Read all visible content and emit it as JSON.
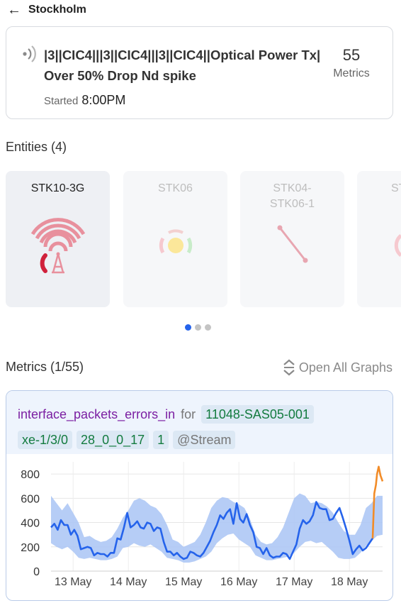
{
  "header": {
    "title": "Stockholm"
  },
  "alarm": {
    "title": "|3||CIC4|||3||CIC4|||3||CIC4||Optical Power Tx|  Over 50% Drop Nd spike",
    "started_label": "Started",
    "started_time": "8:00PM",
    "metric_count": "55",
    "metric_label": "Metrics"
  },
  "entities": {
    "heading": "Entities (4)",
    "items": [
      {
        "name": "STK10-3G",
        "icon": "cell-tower-icon",
        "active": true
      },
      {
        "name": "STK06",
        "icon": "status-light-icon",
        "active": false
      },
      {
        "name": "STK04-\nSTK06-1",
        "icon": "link-icon",
        "active": false
      },
      {
        "name": "ST",
        "icon": "partial-icon",
        "active": false
      }
    ],
    "pager": {
      "pages": 3,
      "current": 0
    }
  },
  "metrics": {
    "heading": "Metrics (1/55)",
    "open_all_label": "Open All Graphs",
    "card": {
      "metric_name": "interface_packets_errors_in",
      "for_label": "for",
      "tags": [
        "11048-SAS05-001",
        "xe-1/3/0",
        "28_0_0_17",
        "1"
      ],
      "stream_tag": "@Stream"
    }
  },
  "colors": {
    "accent": "#2563eb",
    "metric_purple": "#7b1fa2",
    "tag_green": "#137b3f",
    "band": "#a9c4f5",
    "anomaly": "#f28c28",
    "alert_red": "#d0213b"
  },
  "chart_data": {
    "type": "line",
    "title": "",
    "xlabel": "",
    "ylabel": "",
    "ylim": [
      0,
      900
    ],
    "yticks": [
      0,
      200,
      400,
      600,
      800
    ],
    "xticks": [
      "13 May",
      "14 May",
      "15 May",
      "16 May",
      "17 May",
      "18 May"
    ],
    "x_start_day": 12.6,
    "x_end_day": 18.5,
    "series": [
      {
        "name": "",
        "role": "value",
        "x": [
          12.6,
          12.66,
          12.72,
          12.78,
          12.84,
          12.9,
          12.96,
          13.02,
          13.08,
          13.14,
          13.2,
          13.26,
          13.32,
          13.38,
          13.44,
          13.5,
          13.56,
          13.62,
          13.68,
          13.74,
          13.8,
          13.86,
          13.92,
          13.98,
          14.04,
          14.1,
          14.16,
          14.22,
          14.28,
          14.34,
          14.4,
          14.46,
          14.52,
          14.58,
          14.64,
          14.7,
          14.76,
          14.82,
          14.88,
          14.94,
          15.0,
          15.06,
          15.12,
          15.18,
          15.24,
          15.3,
          15.36,
          15.42,
          15.48,
          15.54,
          15.6,
          15.66,
          15.72,
          15.78,
          15.84,
          15.9,
          15.96,
          16.02,
          16.08,
          16.14,
          16.2,
          16.26,
          16.32,
          16.38,
          16.44,
          16.5,
          16.56,
          16.62,
          16.68,
          16.74,
          16.8,
          16.86,
          16.92,
          16.98,
          17.04,
          17.1,
          17.16,
          17.22,
          17.28,
          17.34,
          17.4,
          17.46,
          17.52,
          17.58,
          17.64,
          17.7,
          17.76,
          17.82,
          17.88,
          17.94,
          18.0,
          18.06,
          18.12,
          18.18,
          18.24,
          18.3,
          18.36,
          18.42
        ],
        "y": [
          360,
          390,
          340,
          420,
          380,
          380,
          300,
          340,
          290,
          180,
          190,
          200,
          190,
          130,
          150,
          140,
          140,
          120,
          150,
          150,
          270,
          260,
          360,
          480,
          360,
          380,
          410,
          360,
          350,
          400,
          390,
          330,
          360,
          350,
          240,
          160,
          160,
          130,
          150,
          120,
          100,
          110,
          160,
          150,
          130,
          120,
          150,
          200,
          250,
          320,
          380,
          460,
          430,
          480,
          510,
          390,
          560,
          430,
          400,
          470,
          380,
          320,
          200,
          190,
          140,
          190,
          130,
          110,
          120,
          120,
          150,
          140,
          100,
          160,
          220,
          350,
          420,
          390,
          410,
          460,
          570,
          520,
          510,
          510,
          420,
          430,
          480,
          520,
          440,
          350,
          250,
          140,
          180,
          210,
          170,
          190,
          230,
          270
        ]
      },
      {
        "name": "",
        "role": "anomaly",
        "x": [
          18.42,
          18.45,
          18.48,
          18.5,
          18.53,
          18.56,
          18.6
        ],
        "y": [
          270,
          640,
          710,
          800,
          860,
          790,
          740
        ]
      }
    ],
    "band": {
      "x": [
        12.6,
        12.7,
        12.8,
        12.9,
        13.0,
        13.1,
        13.2,
        13.3,
        13.4,
        13.5,
        13.6,
        13.7,
        13.8,
        13.9,
        14.0,
        14.1,
        14.2,
        14.3,
        14.4,
        14.5,
        14.6,
        14.7,
        14.8,
        14.9,
        15.0,
        15.1,
        15.2,
        15.3,
        15.4,
        15.5,
        15.6,
        15.7,
        15.8,
        15.9,
        16.0,
        16.1,
        16.2,
        16.3,
        16.4,
        16.5,
        16.6,
        16.7,
        16.8,
        16.9,
        17.0,
        17.1,
        17.2,
        17.3,
        17.4,
        17.5,
        17.6,
        17.7,
        17.8,
        17.9,
        18.0,
        18.1,
        18.2,
        18.3,
        18.4,
        18.5,
        18.6
      ],
      "upper": [
        620,
        560,
        500,
        560,
        480,
        400,
        280,
        290,
        260,
        240,
        250,
        280,
        350,
        440,
        500,
        580,
        600,
        580,
        540,
        520,
        470,
        380,
        260,
        240,
        200,
        220,
        240,
        300,
        400,
        520,
        580,
        610,
        600,
        570,
        550,
        520,
        430,
        300,
        240,
        220,
        230,
        280,
        360,
        480,
        600,
        640,
        620,
        560,
        570,
        560,
        530,
        480,
        400,
        330,
        300,
        300,
        380,
        520,
        560,
        620,
        620
      ],
      "lower": [
        230,
        200,
        180,
        200,
        160,
        110,
        100,
        110,
        100,
        90,
        90,
        100,
        120,
        190,
        200,
        230,
        210,
        200,
        220,
        190,
        160,
        110,
        100,
        90,
        70,
        70,
        80,
        100,
        120,
        160,
        230,
        270,
        300,
        310,
        260,
        230,
        200,
        130,
        110,
        90,
        90,
        100,
        110,
        120,
        150,
        200,
        240,
        250,
        230,
        240,
        200,
        160,
        110,
        100,
        100,
        110,
        150,
        210,
        250,
        290,
        300
      ]
    }
  }
}
